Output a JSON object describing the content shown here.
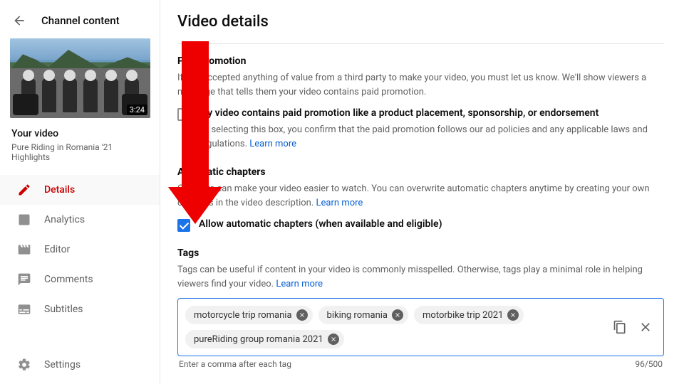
{
  "sidebar": {
    "header_title": "Channel content",
    "thumb_duration": "3:24",
    "meta_title": "Your video",
    "meta_sub": "Pure Riding in Romania '21 Highlights",
    "nav": [
      {
        "label": "Details",
        "icon": "pencil",
        "active": true
      },
      {
        "label": "Analytics",
        "icon": "bars",
        "active": false
      },
      {
        "label": "Editor",
        "icon": "clapper",
        "active": false
      },
      {
        "label": "Comments",
        "icon": "comment",
        "active": false
      },
      {
        "label": "Subtitles",
        "icon": "subtitles",
        "active": false
      }
    ],
    "settings_label": "Settings"
  },
  "main": {
    "title": "Video details",
    "paid_promotion": {
      "heading": "Paid promotion",
      "desc": "If you accepted anything of value from a third party to make your video, you must let us know. We'll show viewers a message that tells them your video contains paid promotion.",
      "checkbox_label": "My video contains paid promotion like a product placement, sponsorship, or endorsement",
      "checkbox_sub_pre": "By selecting this box, you confirm that the paid promotion follows our ad policies and any applicable laws and regulations. ",
      "learn_more": "Learn more"
    },
    "auto_chapters": {
      "heading": "Automatic chapters",
      "desc_pre": "Chapters can make your video easier to watch. You can overwrite automatic chapters anytime by creating your own chapters in the video description. ",
      "learn_more": "Learn more",
      "checkbox_label": "Allow automatic chapters (when available and eligible)",
      "checked": true
    },
    "tags": {
      "heading": "Tags",
      "desc_pre": "Tags can be useful if content in your video is commonly misspelled. Otherwise, tags play a minimal role in helping viewers find your video. ",
      "learn_more": "Learn more",
      "chips": [
        "motorcycle trip romania",
        "biking romania",
        "motorbike trip 2021",
        "pureRiding group romania 2021"
      ],
      "hint": "Enter a comma after each tag",
      "counter": "96/500"
    }
  }
}
